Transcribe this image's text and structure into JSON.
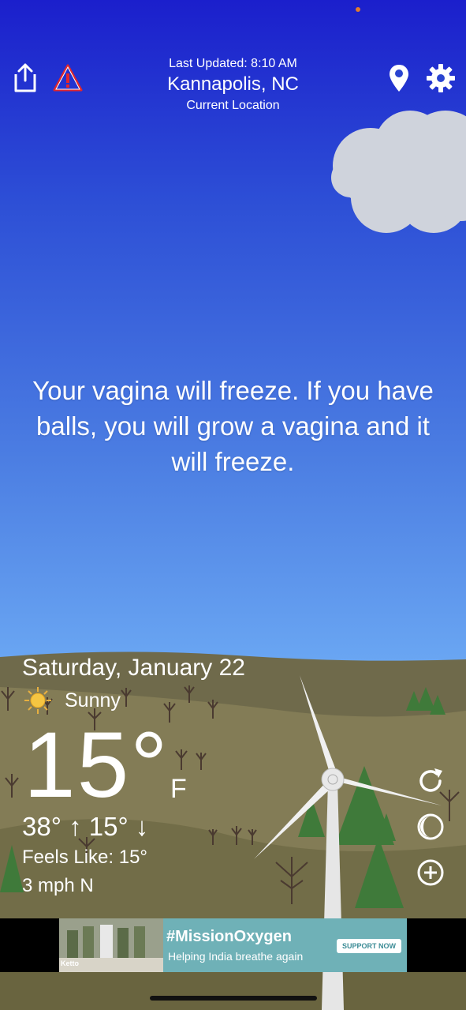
{
  "header": {
    "last_updated": "Last Updated: 8:10 AM",
    "location": "Kannapolis, NC",
    "location_sub": "Current Location"
  },
  "message": "Your vagina will freeze. If you have balls, you will grow a vagina and it will freeze.",
  "weather": {
    "date": "Saturday, January 22",
    "condition": "Sunny",
    "temperature": "15°",
    "unit": "F",
    "hi_lo": "38° ↑ 15° ↓",
    "feels_like": "Feels Like: 15°",
    "wind": "3 mph N"
  },
  "icons": {
    "share": "share-icon",
    "alert": "alert-triangle-icon",
    "location": "location-pin-icon",
    "settings": "gear-icon",
    "refresh": "refresh-icon",
    "moon": "moon-icon",
    "add": "add-icon",
    "sun": "sun-icon"
  },
  "ad": {
    "title": "#MissionOxygen",
    "subtitle": "Helping India breathe again",
    "button": "SUPPORT NOW",
    "logo": "Ketto"
  },
  "colors": {
    "sky_top": "#1b1fcc",
    "sky_bottom": "#7db8f7",
    "hill": "#7a7452",
    "alert_red": "#e0262e",
    "ad_bg": "#6fb1b7"
  }
}
